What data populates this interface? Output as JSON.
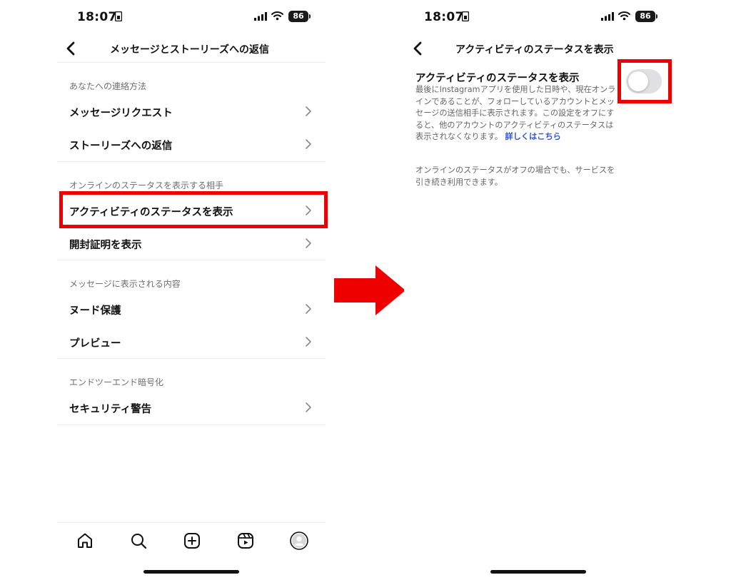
{
  "left_screen": {
    "status": {
      "time": "18:07",
      "battery": "86"
    },
    "header": {
      "title": "メッセージとストーリーズへの返信"
    },
    "sections": [
      {
        "header": "あなたへの連絡方法",
        "items": [
          {
            "label": "メッセージリクエスト"
          },
          {
            "label": "ストーリーズへの返信"
          }
        ]
      },
      {
        "header": "オンラインのステータスを表示する相手",
        "items": [
          {
            "label": "アクティビティのステータスを表示"
          },
          {
            "label": "開封証明を表示"
          }
        ]
      },
      {
        "header": "メッセージに表示される内容",
        "items": [
          {
            "label": "ヌード保護"
          },
          {
            "label": "プレビュー"
          }
        ]
      },
      {
        "header": "エンドツーエンド暗号化",
        "items": [
          {
            "label": "セキュリティ警告"
          }
        ]
      }
    ],
    "bottom_tabs": [
      "home-icon",
      "search-icon",
      "create-icon",
      "reels-icon",
      "profile-icon"
    ]
  },
  "right_screen": {
    "status": {
      "time": "18:07",
      "battery": "86"
    },
    "header": {
      "title": "アクティビティのステータスを表示"
    },
    "setting": {
      "title": "アクティビティのステータスを表示",
      "description": "最後にInstagramアプリを使用した日時や、現在オンラインであることが、フォローしているアカウントとメッセージの送信相手に表示されます。この設定をオフにすると、他のアカウントのアクティビティのステータスは表示されなくなります。",
      "link": "詳しくはこちら",
      "note": "オンラインのステータスがオフの場合でも、サービスを引き続き利用できます。",
      "toggle_on": false
    }
  },
  "colors": {
    "highlight": "#ee0000",
    "arrow": "#ee0000",
    "link": "#2f55d4",
    "toggle_off": "#e0e0e3"
  },
  "transition": "arrow-right-icon"
}
